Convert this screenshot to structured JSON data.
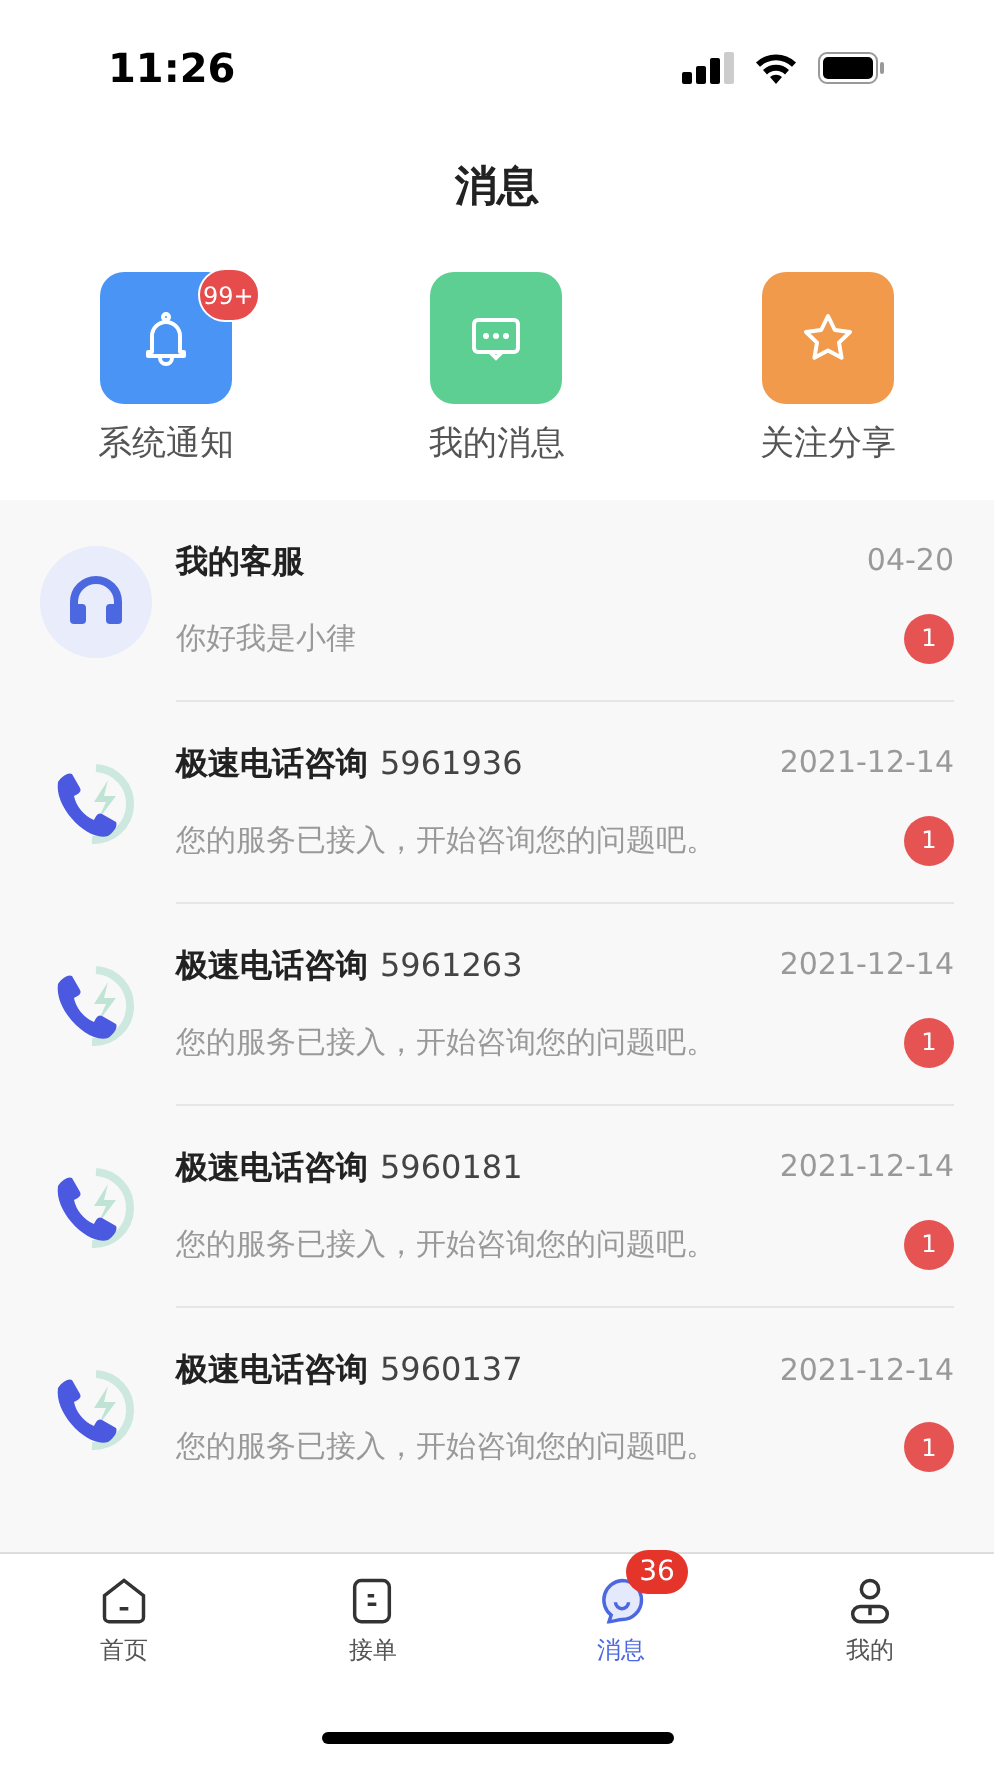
{
  "status_bar": {
    "time": "11:26"
  },
  "header": {
    "title": "消息"
  },
  "shortcuts": [
    {
      "kind": "bell",
      "label": "系统通知",
      "color": "#4a94f5",
      "badge": "99+"
    },
    {
      "kind": "chat",
      "label": "我的消息",
      "color": "#5ecf92"
    },
    {
      "kind": "star",
      "label": "关注分享",
      "color": "#f19a4c"
    }
  ],
  "conversations": [
    {
      "kind": "service",
      "title": "我的客服",
      "date": "04-20",
      "preview": "你好我是小律",
      "unread": "1"
    },
    {
      "kind": "phone",
      "title": "极速电话咨询",
      "number": "5961936",
      "date": "2021-12-14",
      "preview": "您的服务已接入，开始咨询您的问题吧。",
      "unread": "1"
    },
    {
      "kind": "phone",
      "title": "极速电话咨询",
      "number": "5961263",
      "date": "2021-12-14",
      "preview": "您的服务已接入，开始咨询您的问题吧。",
      "unread": "1"
    },
    {
      "kind": "phone",
      "title": "极速电话咨询",
      "number": "5960181",
      "date": "2021-12-14",
      "preview": "您的服务已接入，开始咨询您的问题吧。",
      "unread": "1"
    },
    {
      "kind": "phone",
      "title": "极速电话咨询",
      "number": "5960137",
      "date": "2021-12-14",
      "preview": "您的服务已接入，开始咨询您的问题吧。",
      "unread": "1"
    }
  ],
  "tab_bar": [
    {
      "kind": "home",
      "label": "首页",
      "selected": false
    },
    {
      "kind": "orders",
      "label": "接单",
      "selected": false
    },
    {
      "kind": "messages",
      "label": "消息",
      "selected": true,
      "badge": "36"
    },
    {
      "kind": "profile",
      "label": "我的",
      "selected": false
    }
  ]
}
